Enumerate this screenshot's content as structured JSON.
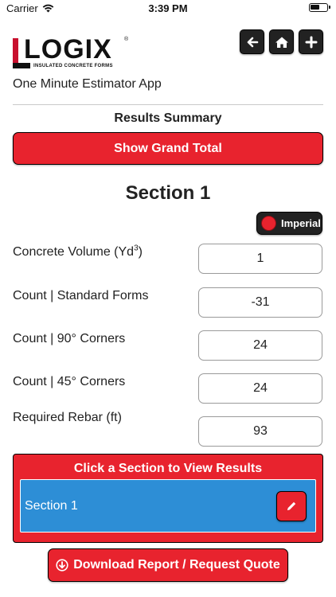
{
  "status_bar": {
    "carrier": "Carrier",
    "time": "3:39 PM"
  },
  "logo": {
    "text": "LOGIX",
    "registered": "®",
    "tagline": "INSULATED CONCRETE FORMS"
  },
  "nav": {
    "icons": [
      "arrow-left-icon",
      "home-icon",
      "plus-icon"
    ]
  },
  "app_subtitle": "One Minute Estimator App",
  "results_summary": "Results Summary",
  "grand_total_label": "Show Grand Total",
  "section_title": "Section 1",
  "unit_toggle": {
    "label": "Imperial"
  },
  "fields": [
    {
      "label": "Concrete Volume (Yd",
      "sup": "3",
      "suffix": ")",
      "value": "1"
    },
    {
      "label": "Count | Standard Forms",
      "value": "-31"
    },
    {
      "label": "Count | 90° Corners",
      "value": "24"
    },
    {
      "label": "Count | 45° Corners",
      "value": "24"
    },
    {
      "label": "Required Rebar (ft)",
      "value": "93"
    }
  ],
  "sections_panel": {
    "header": "Click a Section to View Results",
    "items": [
      {
        "label": "Section 1"
      }
    ]
  },
  "download_label": "Download Report / Request Quote",
  "colors": {
    "accent_red": "#e8232e",
    "section_blue": "#2d8ed6",
    "dark": "#222222"
  }
}
